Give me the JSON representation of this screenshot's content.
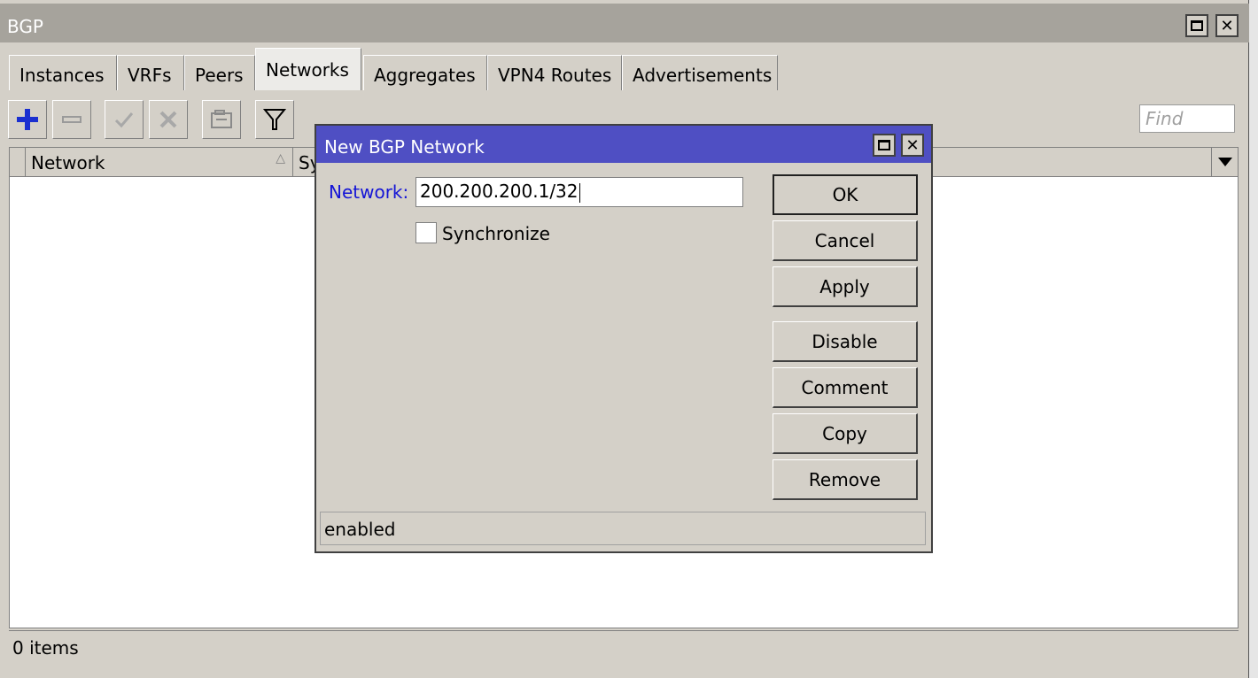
{
  "window": {
    "title": "BGP"
  },
  "tabs": [
    {
      "label": "Instances",
      "active": false
    },
    {
      "label": "VRFs",
      "active": false
    },
    {
      "label": "Peers",
      "active": false
    },
    {
      "label": "Networks",
      "active": true
    },
    {
      "label": "Aggregates",
      "active": false
    },
    {
      "label": "VPN4 Routes",
      "active": false
    },
    {
      "label": "Advertisements",
      "active": false
    }
  ],
  "toolbar": {
    "icons": [
      "add-icon",
      "remove-icon",
      "enable-icon",
      "disable-icon",
      "comment-icon",
      "filter-icon"
    ],
    "find_placeholder": "Find"
  },
  "table": {
    "columns": [
      "Network",
      "Sy"
    ],
    "rows": []
  },
  "status": {
    "count_text": "0 items"
  },
  "dialog": {
    "title": "New BGP Network",
    "network_label": "Network:",
    "network_value": "200.200.200.1/32",
    "synchronize_label": "Synchronize",
    "synchronize_checked": false,
    "buttons": {
      "ok": "OK",
      "cancel": "Cancel",
      "apply": "Apply",
      "disable": "Disable",
      "comment": "Comment",
      "copy": "Copy",
      "remove": "Remove"
    },
    "status": "enabled"
  },
  "colors": {
    "dialog_title_bg": "#4f4fc3",
    "label_blue": "#1414d6",
    "add_icon": "#1a2fd0",
    "window_bg": "#d4d0c8"
  }
}
